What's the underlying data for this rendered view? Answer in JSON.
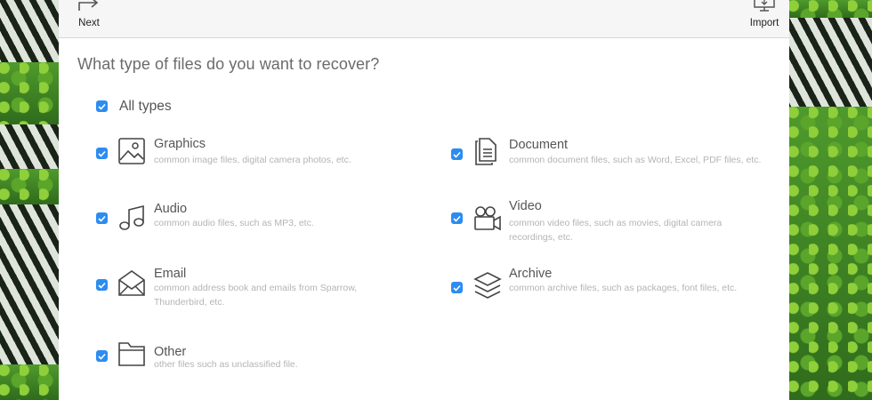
{
  "toolbar": {
    "next_label": "Next",
    "import_label": "Import"
  },
  "heading": "What type of files do you want to recover?",
  "all_types": {
    "label": "All types",
    "checked": true
  },
  "file_types": [
    {
      "id": "graphics",
      "title": "Graphics",
      "description": "common image files, digital camera photos, etc.",
      "icon": "image-icon",
      "checked": true
    },
    {
      "id": "document",
      "title": "Document",
      "description": "common document files, such as Word, Excel, PDF files, etc.",
      "icon": "document-icon",
      "checked": true
    },
    {
      "id": "audio",
      "title": "Audio",
      "description": "common audio files, such as MP3, etc.",
      "icon": "music-note-icon",
      "checked": true
    },
    {
      "id": "video",
      "title": "Video",
      "description": "common video files, such as movies, digital camera recordings, etc.",
      "icon": "video-camera-icon",
      "checked": true
    },
    {
      "id": "email",
      "title": "Email",
      "description": "common address book and emails from Sparrow, Thunderbird, etc.",
      "icon": "envelope-icon",
      "checked": true
    },
    {
      "id": "archive",
      "title": "Archive",
      "description": "common archive files, such as packages, font files, etc.",
      "icon": "layers-icon",
      "checked": true
    },
    {
      "id": "other",
      "title": "Other",
      "description": "other files such as unclassified file.",
      "icon": "folder-icon",
      "checked": true
    }
  ],
  "colors": {
    "checkbox": "#2d8cf0",
    "title_text": "#555555",
    "description_text": "#b4b4b4",
    "heading_text": "#6b6b6b",
    "toolbar_bg": "#f6f6f6"
  }
}
